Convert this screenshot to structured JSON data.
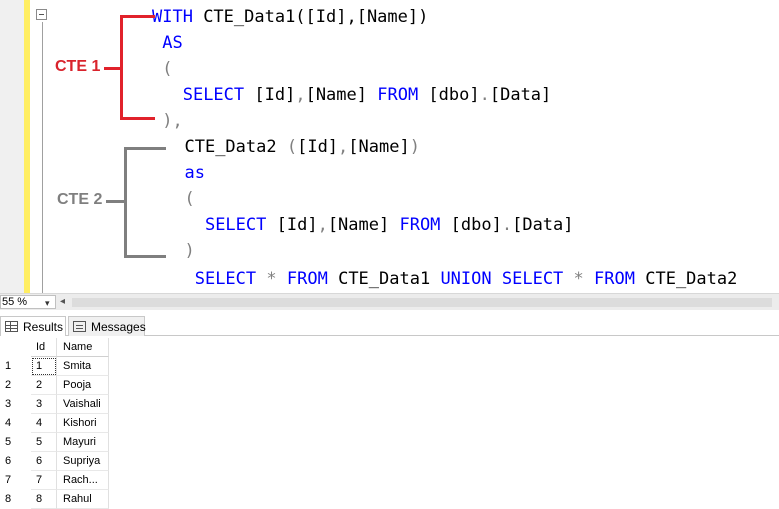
{
  "editor": {
    "code_lines": [
      {
        "indent": "",
        "tokens": [
          {
            "text": "WITH",
            "cls": "kw"
          },
          {
            "text": " CTE_Data1([Id],[Name])",
            "cls": ""
          }
        ]
      },
      {
        "indent": " ",
        "tokens": [
          {
            "text": "AS",
            "cls": "kw"
          }
        ]
      },
      {
        "indent": " ",
        "tokens": [
          {
            "text": "(",
            "cls": "op"
          }
        ]
      },
      {
        "indent": "   ",
        "tokens": [
          {
            "text": "SELECT",
            "cls": "kw"
          },
          {
            "text": " [Id]",
            "cls": ""
          },
          {
            "text": ",",
            "cls": "op"
          },
          {
            "text": "[Name] ",
            "cls": ""
          },
          {
            "text": "FROM",
            "cls": "kw"
          },
          {
            "text": " [dbo]",
            "cls": ""
          },
          {
            "text": ".",
            "cls": "op"
          },
          {
            "text": "[Data]",
            "cls": ""
          }
        ]
      },
      {
        "indent": " ",
        "tokens": [
          {
            "text": ")",
            "cls": "op"
          },
          {
            "text": ",",
            "cls": "op"
          }
        ]
      },
      {
        "indent": "  ",
        "tokens": [
          {
            "text": "CTE_Data2 ",
            "cls": ""
          },
          {
            "text": "(",
            "cls": "op"
          },
          {
            "text": "[Id]",
            "cls": ""
          },
          {
            "text": ",",
            "cls": "op"
          },
          {
            "text": "[Name]",
            "cls": ""
          },
          {
            "text": ")",
            "cls": "op"
          }
        ]
      },
      {
        "indent": "  ",
        "tokens": [
          {
            "text": "as",
            "cls": "kw"
          }
        ]
      },
      {
        "indent": "  ",
        "tokens": [
          {
            "text": "(",
            "cls": "op"
          }
        ]
      },
      {
        "indent": "    ",
        "tokens": [
          {
            "text": "SELECT",
            "cls": "kw"
          },
          {
            "text": " [Id]",
            "cls": ""
          },
          {
            "text": ",",
            "cls": "op"
          },
          {
            "text": "[Name] ",
            "cls": ""
          },
          {
            "text": "FROM",
            "cls": "kw"
          },
          {
            "text": " [dbo]",
            "cls": ""
          },
          {
            "text": ".",
            "cls": "op"
          },
          {
            "text": "[Data]",
            "cls": ""
          }
        ]
      },
      {
        "indent": "  ",
        "tokens": [
          {
            "text": ")",
            "cls": "op"
          }
        ]
      },
      {
        "indent": "   ",
        "tokens": [
          {
            "text": "SELECT",
            "cls": "kw"
          },
          {
            "text": " ",
            "cls": ""
          },
          {
            "text": "*",
            "cls": "op"
          },
          {
            "text": " ",
            "cls": ""
          },
          {
            "text": "FROM",
            "cls": "kw"
          },
          {
            "text": " CTE_Data1 ",
            "cls": ""
          },
          {
            "text": "UNION",
            "cls": "kw"
          },
          {
            "text": " ",
            "cls": ""
          },
          {
            "text": "SELECT",
            "cls": "kw"
          },
          {
            "text": " ",
            "cls": ""
          },
          {
            "text": "*",
            "cls": "op"
          },
          {
            "text": " ",
            "cls": ""
          },
          {
            "text": "FROM",
            "cls": "kw"
          },
          {
            "text": " CTE_Data2",
            "cls": ""
          }
        ]
      }
    ],
    "annotations": {
      "cte1_label": "CTE 1",
      "cte2_label": "CTE 2",
      "cte1_color": "#e1222b",
      "cte2_color": "#7f7f7f"
    },
    "colors": {
      "keyword": "#0000ff",
      "operator": "#808080",
      "change_bar": "#ffee62"
    }
  },
  "status": {
    "zoom_label": "55 %",
    "zoom_arrow": "▾",
    "scroll_left": "◂"
  },
  "tabs": {
    "results_label": "Results",
    "messages_label": "Messages"
  },
  "grid": {
    "columns": [
      "Id",
      "Name"
    ],
    "rows": [
      {
        "num": "1",
        "id": "1",
        "name": "Smita"
      },
      {
        "num": "2",
        "id": "2",
        "name": "Pooja"
      },
      {
        "num": "3",
        "id": "3",
        "name": "Vaishali"
      },
      {
        "num": "4",
        "id": "4",
        "name": "Kishori"
      },
      {
        "num": "5",
        "id": "5",
        "name": "Mayuri"
      },
      {
        "num": "6",
        "id": "6",
        "name": "Supriya"
      },
      {
        "num": "7",
        "id": "7",
        "name": "Rach..."
      },
      {
        "num": "8",
        "id": "8",
        "name": "Rahul"
      }
    ]
  }
}
